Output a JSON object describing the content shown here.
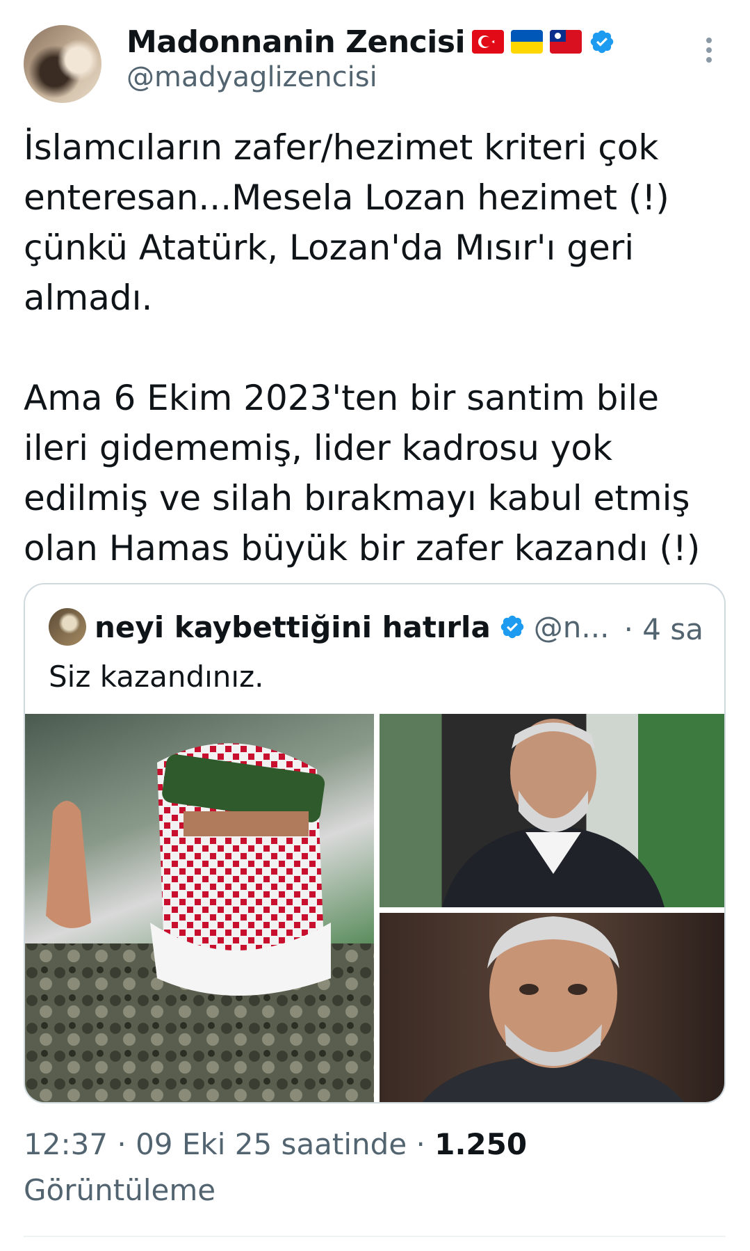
{
  "tweet": {
    "author": {
      "display_name": "Madonnanin Zencisi",
      "handle": "@madyaglizencisi",
      "flags": [
        "turkey-flag-icon",
        "ukraine-flag-icon",
        "taiwan-flag-icon"
      ],
      "verified": true
    },
    "text": "İslamcıların zafer/hezimet kriteri çok enteresan...Mesela Lozan hezimet (!) çünkü Atatürk, Lozan'da Mısır'ı geri almadı.\n\nAma 6 Ekim 2023'ten bir santim bile ileri gidememiş, lider kadrosu yok edilmiş ve silah bırakmayı kabul etmiş olan Hamas büyük bir zafer kazandı (!)",
    "timestamp": "12:37 · 09 Eki 25 saatinde · ",
    "views_count": "1.250",
    "views_label": "Görüntüleme"
  },
  "quoted_tweet": {
    "display_name": "neyi kaybettiğini hatırla",
    "handle": "@n...",
    "time": "· 4 sa",
    "verified": true,
    "text": "Siz kazandınız.",
    "media": [
      "masked-militant-photo",
      "older-man-in-suit-photo",
      "grey-haired-man-photo"
    ]
  },
  "colors": {
    "text_primary": "#0f1419",
    "text_secondary": "#536471",
    "verified_blue": "#1d9bf0",
    "border": "#cfd9de"
  }
}
